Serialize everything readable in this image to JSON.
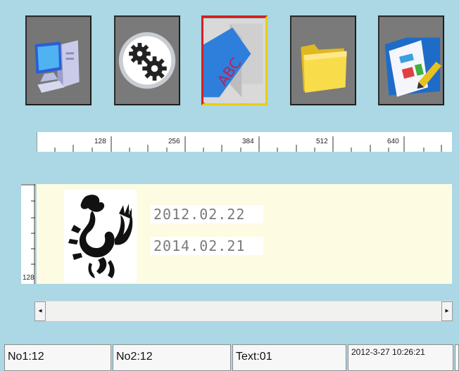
{
  "toolbar": {
    "buttons": [
      {
        "icon": "computer-icon"
      },
      {
        "icon": "gears-icon"
      },
      {
        "icon": "abc-text-icon",
        "active": true
      },
      {
        "icon": "folder-icon"
      },
      {
        "icon": "document-edit-icon"
      }
    ]
  },
  "ruler": {
    "horizontal_labels": [
      "128",
      "256",
      "384",
      "512",
      "640"
    ],
    "vertical_label": "128"
  },
  "canvas": {
    "date1": "2012.02.22",
    "date2": "2014.02.21"
  },
  "statusbar": {
    "no1": "No1:12",
    "no2": "No2:12",
    "text": "Text:01",
    "datetime": "2012-3-27 10:26:21"
  }
}
